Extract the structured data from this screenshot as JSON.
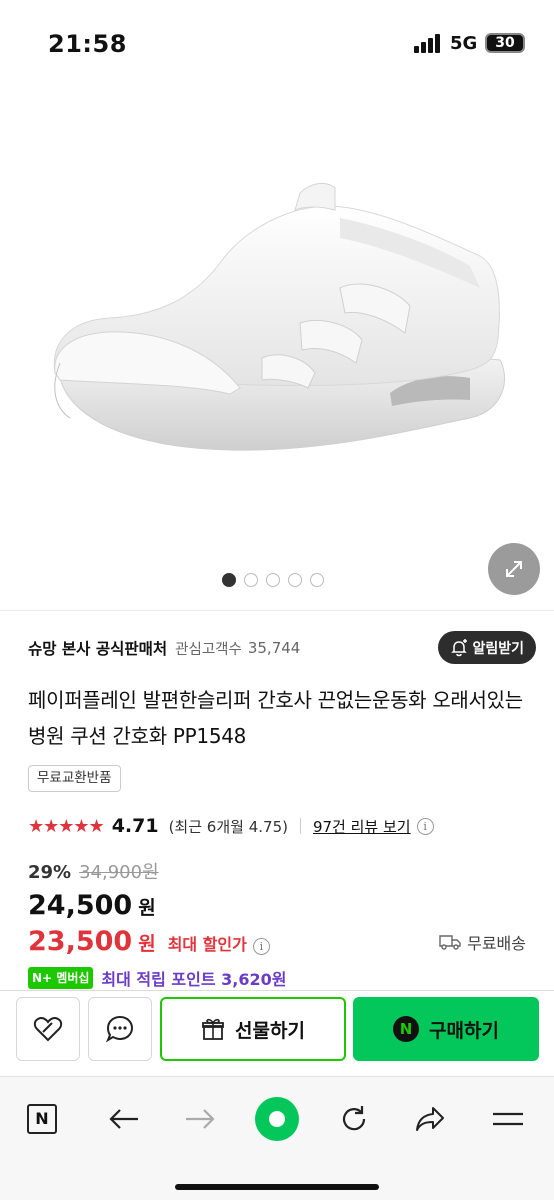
{
  "status": {
    "time": "21:58",
    "network": "5G",
    "battery": "30"
  },
  "gallery": {
    "image_alt": "white slip-on sneaker",
    "total_images": 5,
    "active_index": 0
  },
  "seller": {
    "name": "슈망 본사 공식판매처",
    "interest_label": "관심고객수",
    "interest_count": "35,744",
    "alert_button": "알림받기"
  },
  "product": {
    "title": "페이퍼플레인 발편한슬리퍼 간호사 끈없는운동화 오래서있는 병원 쿠션 간호화 PP1548",
    "badge": "무료교환반품"
  },
  "rating": {
    "stars": "★★★★★",
    "score": "4.71",
    "recent": "(최근 6개월 4.75)",
    "review_link": "97건 리뷰 보기",
    "info": "i"
  },
  "price": {
    "discount_rate": "29%",
    "original": "34,900원",
    "sale": "24,500",
    "sale_unit": "원",
    "best": "23,500",
    "best_unit": "원",
    "best_label": "최대 할인가",
    "shipping": "무료배송"
  },
  "points": {
    "tag": "N+ 멤버십",
    "text": "최대 적립 포인트 3,620원"
  },
  "actions": {
    "gift": "선물하기",
    "buy": "구매하기",
    "buy_icon_letter": "N"
  },
  "browser": {
    "home_letter": "N"
  },
  "colors": {
    "accent_green": "#03c75a",
    "price_red": "#e0343c",
    "point_purple": "#6a3cc8"
  }
}
